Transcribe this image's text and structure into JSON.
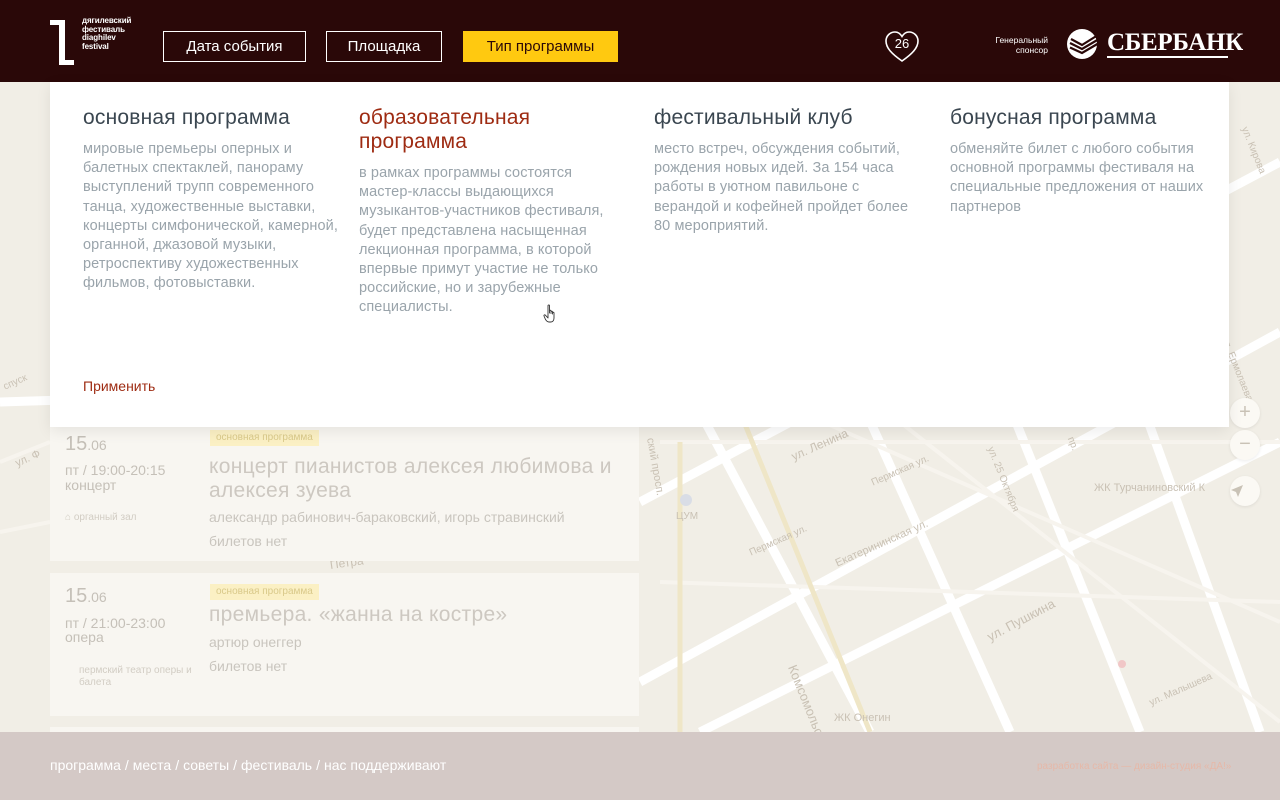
{
  "header": {
    "logo_lines": [
      "дягилевский",
      "фестиваль",
      "diaghilev",
      "festival"
    ],
    "buttons": {
      "date": "Дата события",
      "venue": "Площадка",
      "type": "Тип программы"
    },
    "favorites_count": "26",
    "sponsor_label": "Генеральный спонсор",
    "sponsor_name": "СБЕРБАНК"
  },
  "dropdown": {
    "columns": [
      {
        "title": "основная программа",
        "description": "мировые премьеры оперных и балетных спектаклей, панораму выступлений трупп современного танца, художественные выставки, концерты симфонической, камерной, органной, джазовой музыки, ретроспективу художественных фильмов, фотовыставки."
      },
      {
        "title": "образовательная программа",
        "description": "в рамках программы состоятся мастер-классы выдающихся музыкантов-участников фестиваля, будет представлена насыщенная лекционная программа, в которой впервые примут участие не только российские, но и зарубежные специалисты."
      },
      {
        "title": "фестивальный клуб",
        "description": "место встреч, обсуждения событий, рождения новых идей. За 154 часа работы в уютном павильоне с верандой и кофейней пройдет более 80 мероприятий."
      },
      {
        "title": "бонусная программа",
        "description": "обменяйте билет с любого события основной программы фестиваля на специальные предложения от наших партнеров"
      }
    ],
    "apply_label": "Применить"
  },
  "events": [
    {
      "day": "15",
      "month": ".06",
      "time": "пт / 19:00-20:15",
      "category": "концерт",
      "badge": "основная программа",
      "title": "концерт пианистов алексея любимова и алексея зуева",
      "performers": "александр рабинович-бараковский, игорь стравинский",
      "tickets": "билетов нет",
      "place": "органный зал"
    },
    {
      "day": "15",
      "month": ".06",
      "time": "пт / 21:00-23:00",
      "category": "опера",
      "badge": "основная программа",
      "title": "премьера. «жанна на костре»",
      "performers": "артюр онеггер",
      "tickets": "билетов нет",
      "place": "пермский театр оперы и балета"
    }
  ],
  "map": {
    "labels": {
      "lenina": "ул. Ленина",
      "permskaya_1": "Пермская ул.",
      "permskaya_2": "Пермская ул.",
      "ekaterininskaya": "Екатерининская ул.",
      "pushkina": "ул. Пушкина",
      "komsomolsky": "Комсомольский",
      "oktyabrya": "ул. 25 Октября",
      "turchaninovsky": "ЖК Турчаниновский К",
      "onegin": "ЖК Онегин",
      "tsum": "ЦУМ",
      "malysheva": "ул. Малышева",
      "prosp": "ский просп.",
      "petra": "Петра",
      "spusk": "спуск",
      "ul": "ул. Ф",
      "kirova": "ул. Кирова",
      "ermolaeva": "ул. Ермолаева",
      "vtoroy": "пр."
    },
    "zoom_in": "+",
    "zoom_out": "−"
  },
  "footer": {
    "nav": [
      "программа",
      "места",
      "советы",
      "фестиваль",
      "нас поддерживают"
    ],
    "separator": "/",
    "credit": "разработка сайта — дизайн-студия «ДА!»"
  }
}
